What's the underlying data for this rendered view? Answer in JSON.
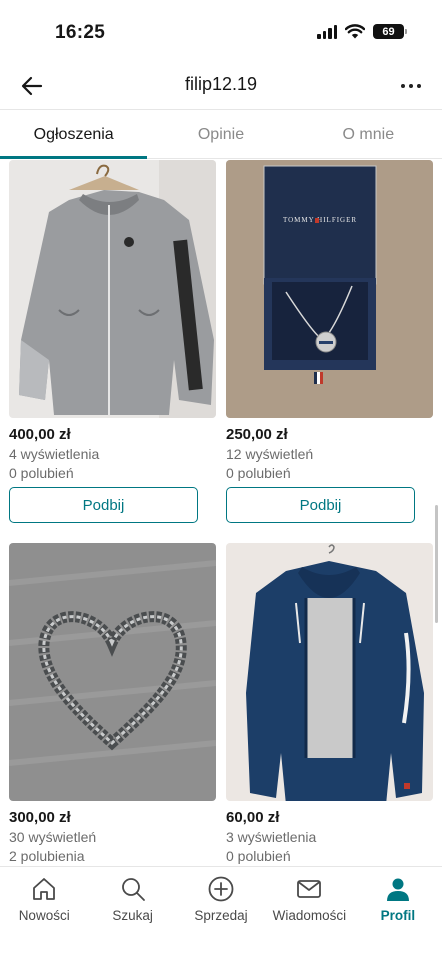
{
  "status_bar": {
    "time": "16:25",
    "battery": "69"
  },
  "header": {
    "title": "filip12.19"
  },
  "tabs": [
    {
      "label": "Ogłoszenia",
      "active": true
    },
    {
      "label": "Opinie",
      "active": false
    },
    {
      "label": "O mnie",
      "active": false
    }
  ],
  "items": [
    {
      "price": "400,00 zł",
      "views": "4 wyświetlenia",
      "likes": "0 polubień",
      "bump_label": "Podbij",
      "image": "grey-jordan-jacket"
    },
    {
      "price": "250,00 zł",
      "views": "12 wyświetleń",
      "likes": "0 polubień",
      "bump_label": "Podbij",
      "image": "tommy-hilfiger-necklace-box",
      "box_text": "TOMMY HILFIGER"
    },
    {
      "price": "300,00 zł",
      "views": "30 wyświetleń",
      "likes": "2 polubienia",
      "image": "silver-chain-heart"
    },
    {
      "price": "60,00 zł",
      "views": "3 wyświetlenia",
      "likes": "0 polubień",
      "image": "navy-champion-hoodie"
    }
  ],
  "bottom_nav": [
    {
      "label": "Nowości",
      "icon": "home-icon",
      "active": false
    },
    {
      "label": "Szukaj",
      "icon": "search-icon",
      "active": false
    },
    {
      "label": "Sprzedaj",
      "icon": "plus-circle-icon",
      "active": false
    },
    {
      "label": "Wiadomości",
      "icon": "mail-icon",
      "active": false
    },
    {
      "label": "Profil",
      "icon": "profile-icon",
      "active": true
    }
  ],
  "colors": {
    "accent": "#007782",
    "text": "#171717",
    "muted": "#6b6b6b"
  }
}
